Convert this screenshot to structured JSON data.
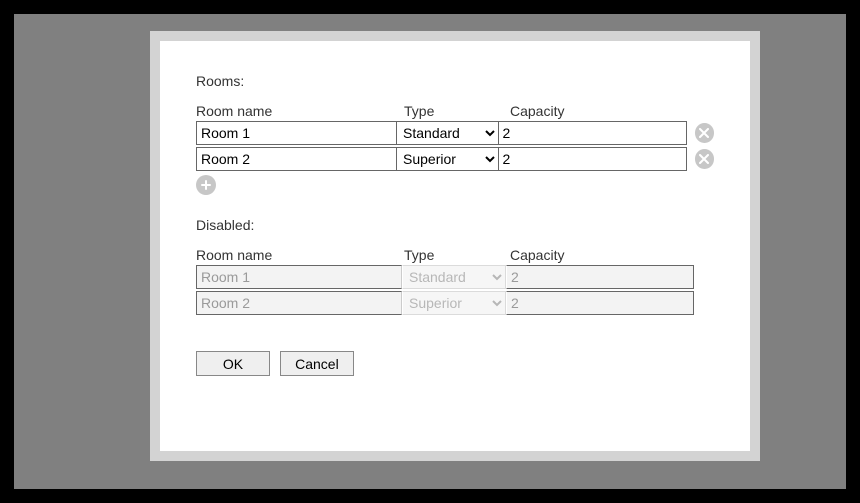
{
  "sections": {
    "enabled_label": "Rooms:",
    "disabled_label": "Disabled:"
  },
  "headers": {
    "name": "Room name",
    "type": "Type",
    "capacity": "Capacity"
  },
  "type_options": [
    "Standard",
    "Superior"
  ],
  "rooms": [
    {
      "name": "Room 1",
      "type": "Standard",
      "capacity": "2"
    },
    {
      "name": "Room 2",
      "type": "Superior",
      "capacity": "2"
    }
  ],
  "disabled_rooms": [
    {
      "name": "Room 1",
      "type": "Standard",
      "capacity": "2"
    },
    {
      "name": "Room 2",
      "type": "Superior",
      "capacity": "2"
    }
  ],
  "buttons": {
    "ok": "OK",
    "cancel": "Cancel"
  },
  "icons": {
    "delete": "close-icon",
    "add": "plus-icon"
  }
}
